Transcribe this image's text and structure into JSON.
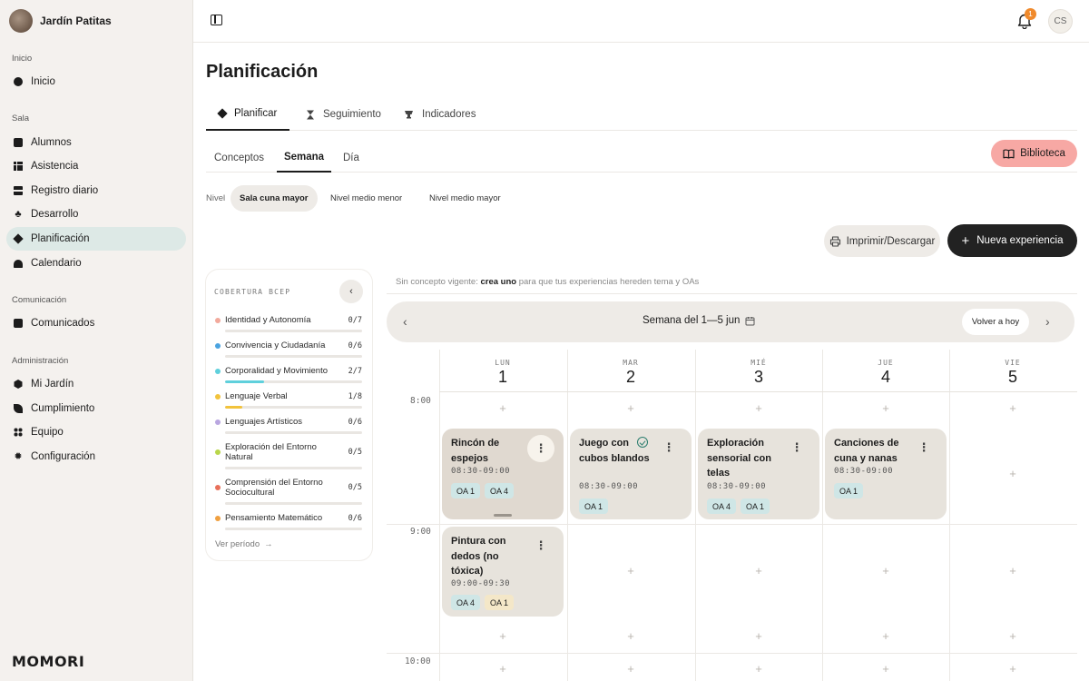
{
  "sidebar": {
    "brand": "Jardín Patitas",
    "sections": {
      "inicio": "Inicio",
      "sala": "Sala",
      "comunicacion": "Comunicación",
      "administracion": "Administración"
    },
    "items": {
      "inicio": "Inicio",
      "alumnos": "Alumnos",
      "asistencia": "Asistencia",
      "registro": "Registro diario",
      "desarrollo": "Desarrollo",
      "planificacion": "Planificación",
      "calendario": "Calendario",
      "comunicados": "Comunicados",
      "mijardin": "Mi Jardín",
      "cumplimiento": "Cumplimiento",
      "equipo": "Equipo",
      "configuracion": "Configuración"
    },
    "logo": "MOMORI"
  },
  "topbar": {
    "notification_count": "1",
    "user_initials": "CS"
  },
  "page": {
    "title": "Planificación",
    "tabs": {
      "planificar": "Planificar",
      "seguimiento": "Seguimiento",
      "indicadores": "Indicadores"
    },
    "subtabs": {
      "conceptos": "Conceptos",
      "semana": "Semana",
      "dia": "Día"
    },
    "biblioteca": "Biblioteca",
    "nivel_label": "Nivel",
    "niveles": {
      "cuna_mayor": "Sala cuna mayor",
      "medio_menor": "Nivel medio menor",
      "medio_mayor": "Nivel medio mayor"
    },
    "print_label": "Imprimir/Descargar",
    "new_label": "Nueva experiencia"
  },
  "coverage": {
    "title": "COBERTURA BCEP",
    "items": [
      {
        "name": "Identidad y Autonomía",
        "frac": "0/7",
        "color": "#f2a99c",
        "fill": 0
      },
      {
        "name": "Convivencia y Ciudadanía",
        "frac": "0/6",
        "color": "#4aa3e0",
        "fill": 0
      },
      {
        "name": "Corporalidad y Movimiento",
        "frac": "2/7",
        "color": "#5fd0dc",
        "fill": 0.2857
      },
      {
        "name": "Lenguaje Verbal",
        "frac": "1/8",
        "color": "#f2c33c",
        "fill": 0.125
      },
      {
        "name": "Lenguajes Artísticos",
        "frac": "0/6",
        "color": "#b9a6e0",
        "fill": 0
      },
      {
        "name": "Exploración del Entorno Natural",
        "frac": "0/5",
        "color": "#b9d64a",
        "fill": 0
      },
      {
        "name": "Comprensión del Entorno Sociocultural",
        "frac": "0/5",
        "color": "#e8705a",
        "fill": 0
      },
      {
        "name": "Pensamiento Matemático",
        "frac": "0/6",
        "color": "#f0a040",
        "fill": 0
      }
    ],
    "more": "Ver período"
  },
  "calendar": {
    "hint_prefix": "Sin concepto vigente:",
    "hint_link": "crea uno",
    "hint_suffix": "para que tus experiencias hereden tema y OAs",
    "week_label": "Semana del 1—5 jun",
    "today_label": "Volver a hoy",
    "days": [
      {
        "abbr": "LUN",
        "num": "1"
      },
      {
        "abbr": "MAR",
        "num": "2"
      },
      {
        "abbr": "MIÉ",
        "num": "3"
      },
      {
        "abbr": "JUE",
        "num": "4"
      },
      {
        "abbr": "VIE",
        "num": "5"
      }
    ],
    "hours": [
      "8:00",
      "9:00",
      "10:00"
    ],
    "events": [
      {
        "title": "Rincón de espejos",
        "time": "08:30-09:00",
        "tags": [
          "OA 1",
          "OA 4"
        ]
      },
      {
        "title": "Juego con cubos blandos",
        "time": "08:30-09:00",
        "tags": [
          "OA 1"
        ]
      },
      {
        "title": "Exploración sensorial con telas",
        "time": "08:30-09:00",
        "tags": [
          "OA 4",
          "OA 1"
        ]
      },
      {
        "title": "Canciones de cuna y nanas",
        "time": "08:30-09:00",
        "tags": [
          "OA 1"
        ]
      },
      {
        "title": "Pintura con dedos (no tóxica)",
        "time": "09:00-09:30",
        "tags": [
          "OA 4",
          "OA 1"
        ]
      }
    ]
  },
  "colors": {
    "accent_active_nav": "#dde9e6",
    "biblioteca": "#f7a8a4",
    "primary_button": "#222222",
    "badge": "#f08a2c"
  }
}
